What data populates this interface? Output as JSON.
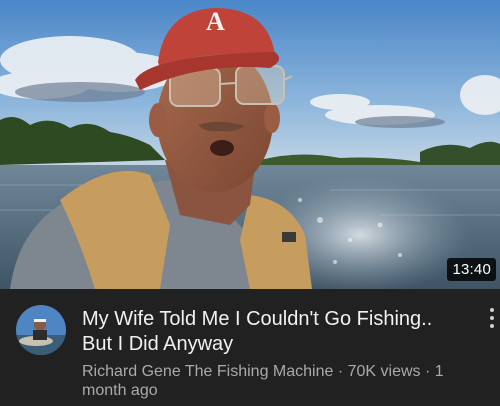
{
  "video": {
    "duration": "13:40",
    "title_line1": "My Wife Told Me I Couldn't Go Fishing..",
    "title_line2": "But I Did Anyway",
    "channel": "Richard Gene The Fishing Machine",
    "separator": "·",
    "views": "70K views",
    "age_part1": "1",
    "age_part2": "month ago",
    "cap_letter": "A"
  },
  "icons": {
    "more": "more-vert-icon",
    "avatar": "channel-avatar-icon"
  },
  "colors": {
    "background": "#212121",
    "title": "#f1f1f1",
    "secondary_text": "#aaaaaa",
    "duration_badge": "#000000",
    "cap": "#c0433a",
    "life_vest": "#c79d5f"
  }
}
